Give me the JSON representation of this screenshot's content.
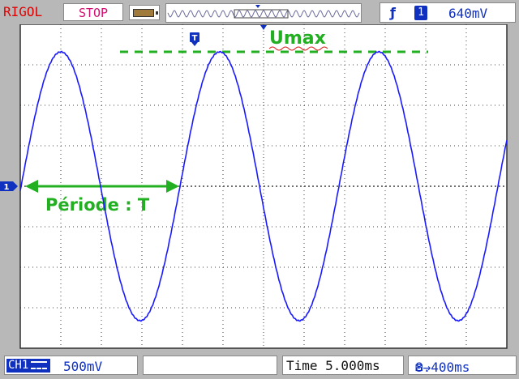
{
  "header": {
    "brand": "RIGOL",
    "run_state": "STOP",
    "trigger": {
      "edge_symbol": "ƒ",
      "source": "1",
      "level": "640mV"
    }
  },
  "annotations": {
    "umax_label": "Umax",
    "period_label": "Période : T"
  },
  "markers": {
    "trigger_position_marker": "T",
    "channel_marker": "1"
  },
  "footer": {
    "channel_label": "CH1",
    "volts_per_div": "500mV",
    "time_base": "Time 5.000ms",
    "trigger_offset": "8.400ms"
  },
  "colors": {
    "trace": "#1a1aff",
    "annotation": "#22b022",
    "grid_border": "#303030",
    "brand": "#e00000",
    "run_state": "#d01070",
    "accent": "#1030c0"
  },
  "chart_data": {
    "type": "line",
    "title": "",
    "xlabel": "",
    "ylabel": "",
    "x_unit": "ms",
    "y_unit": "V",
    "divisions": {
      "horizontal": 12,
      "vertical": 8
    },
    "time_per_div_ms": 5.0,
    "volts_per_div_V": 0.5,
    "xlim": [
      -30,
      30
    ],
    "ylim": [
      -2.0,
      2.0
    ],
    "grid": true,
    "signal": {
      "name": "CH1",
      "shape": "sine",
      "period_ms": 19.6,
      "amplitude_V": 1.66,
      "offset_V": 0.0,
      "x_at_first_visible_peak_ms": -25.0
    },
    "umax_level_V": 1.66,
    "period_arrow_ms": [
      -30.0,
      -10.4
    ]
  }
}
